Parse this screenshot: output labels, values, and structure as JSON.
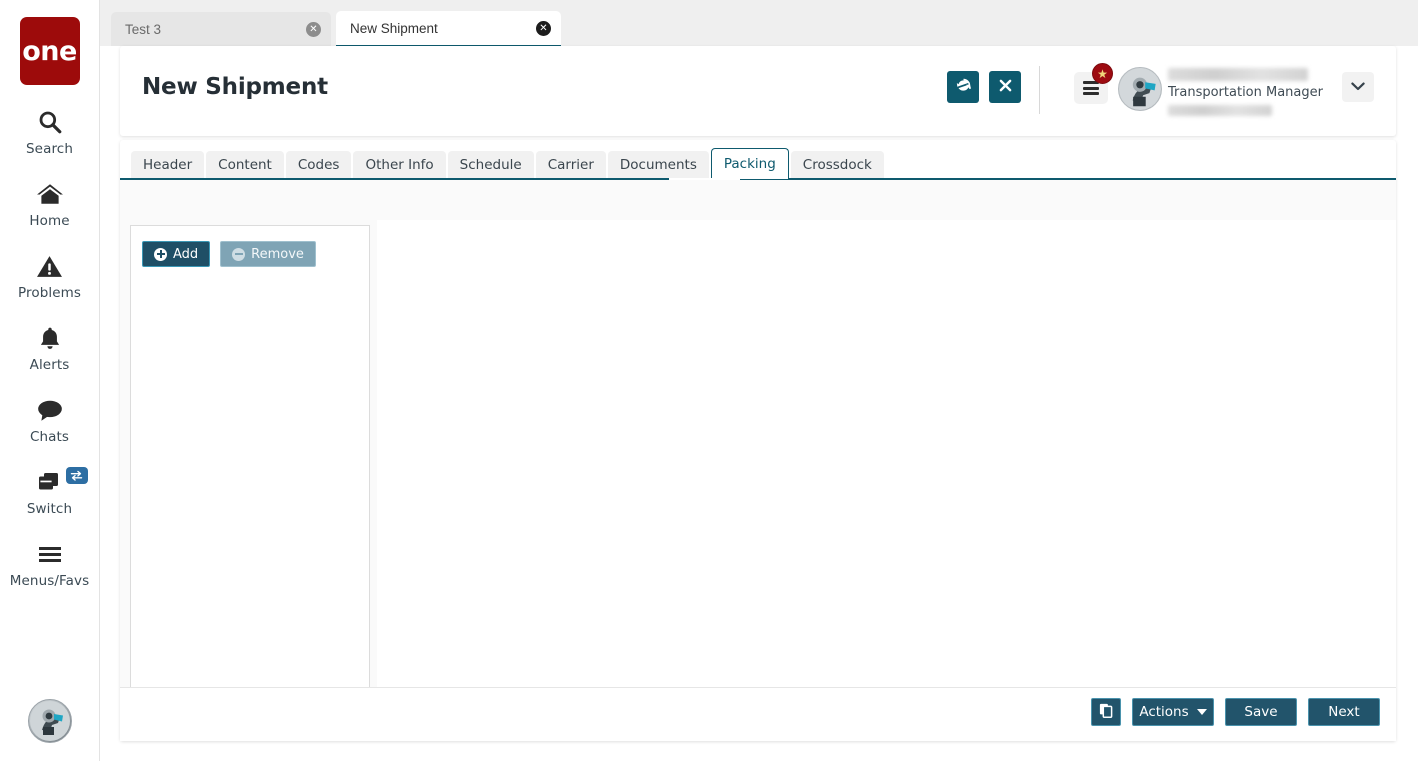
{
  "rail": {
    "logo_text": "one",
    "items": [
      {
        "label": "Search",
        "icon": "search-icon"
      },
      {
        "label": "Home",
        "icon": "home-icon"
      },
      {
        "label": "Problems",
        "icon": "warning-triangle-icon"
      },
      {
        "label": "Alerts",
        "icon": "bell-icon"
      },
      {
        "label": "Chats",
        "icon": "chat-bubble-icon"
      },
      {
        "label": "Switch",
        "icon": "windows-switch-icon"
      },
      {
        "label": "Menus/Favs",
        "icon": "hamburger-icon"
      }
    ]
  },
  "browser_tabs": [
    {
      "label": "Test 3",
      "active": false
    },
    {
      "label": "New Shipment",
      "active": true
    }
  ],
  "header": {
    "title": "New Shipment",
    "refresh_icon": "refresh-icon",
    "close_icon": "close-icon",
    "menu_icon": "menu-icon",
    "star_badge_icon": "star-icon",
    "avatar_icon": "avatar-icon",
    "user_name": "",
    "user_role": "Transportation Manager",
    "user_org": "",
    "caret_icon": "chevron-down-icon"
  },
  "tabs": [
    {
      "label": "Header",
      "active": false
    },
    {
      "label": "Content",
      "active": false
    },
    {
      "label": "Codes",
      "active": false
    },
    {
      "label": "Other Info",
      "active": false
    },
    {
      "label": "Schedule",
      "active": false
    },
    {
      "label": "Carrier",
      "active": false
    },
    {
      "label": "Documents",
      "active": false
    },
    {
      "label": "Packing",
      "active": true
    },
    {
      "label": "Crossdock",
      "active": false
    }
  ],
  "packing_panel": {
    "add_label": "Add",
    "remove_label": "Remove",
    "add_icon": "plus-circle-icon",
    "remove_icon": "minus-circle-icon",
    "remove_disabled": true
  },
  "footer": {
    "copy_icon": "copy-icon",
    "actions_label": "Actions",
    "actions_caret_icon": "caret-down-icon",
    "save_label": "Save",
    "next_label": "Next"
  },
  "colors": {
    "brand_red": "#9d0b0b",
    "accent_teal": "#0e5a6e",
    "button_navy": "#22546b",
    "button_border": "#4a93ad",
    "disabled_gray": "#7fa4b5",
    "badge_red": "#9d0b11",
    "switch_badge_blue": "#2d6ea3"
  }
}
